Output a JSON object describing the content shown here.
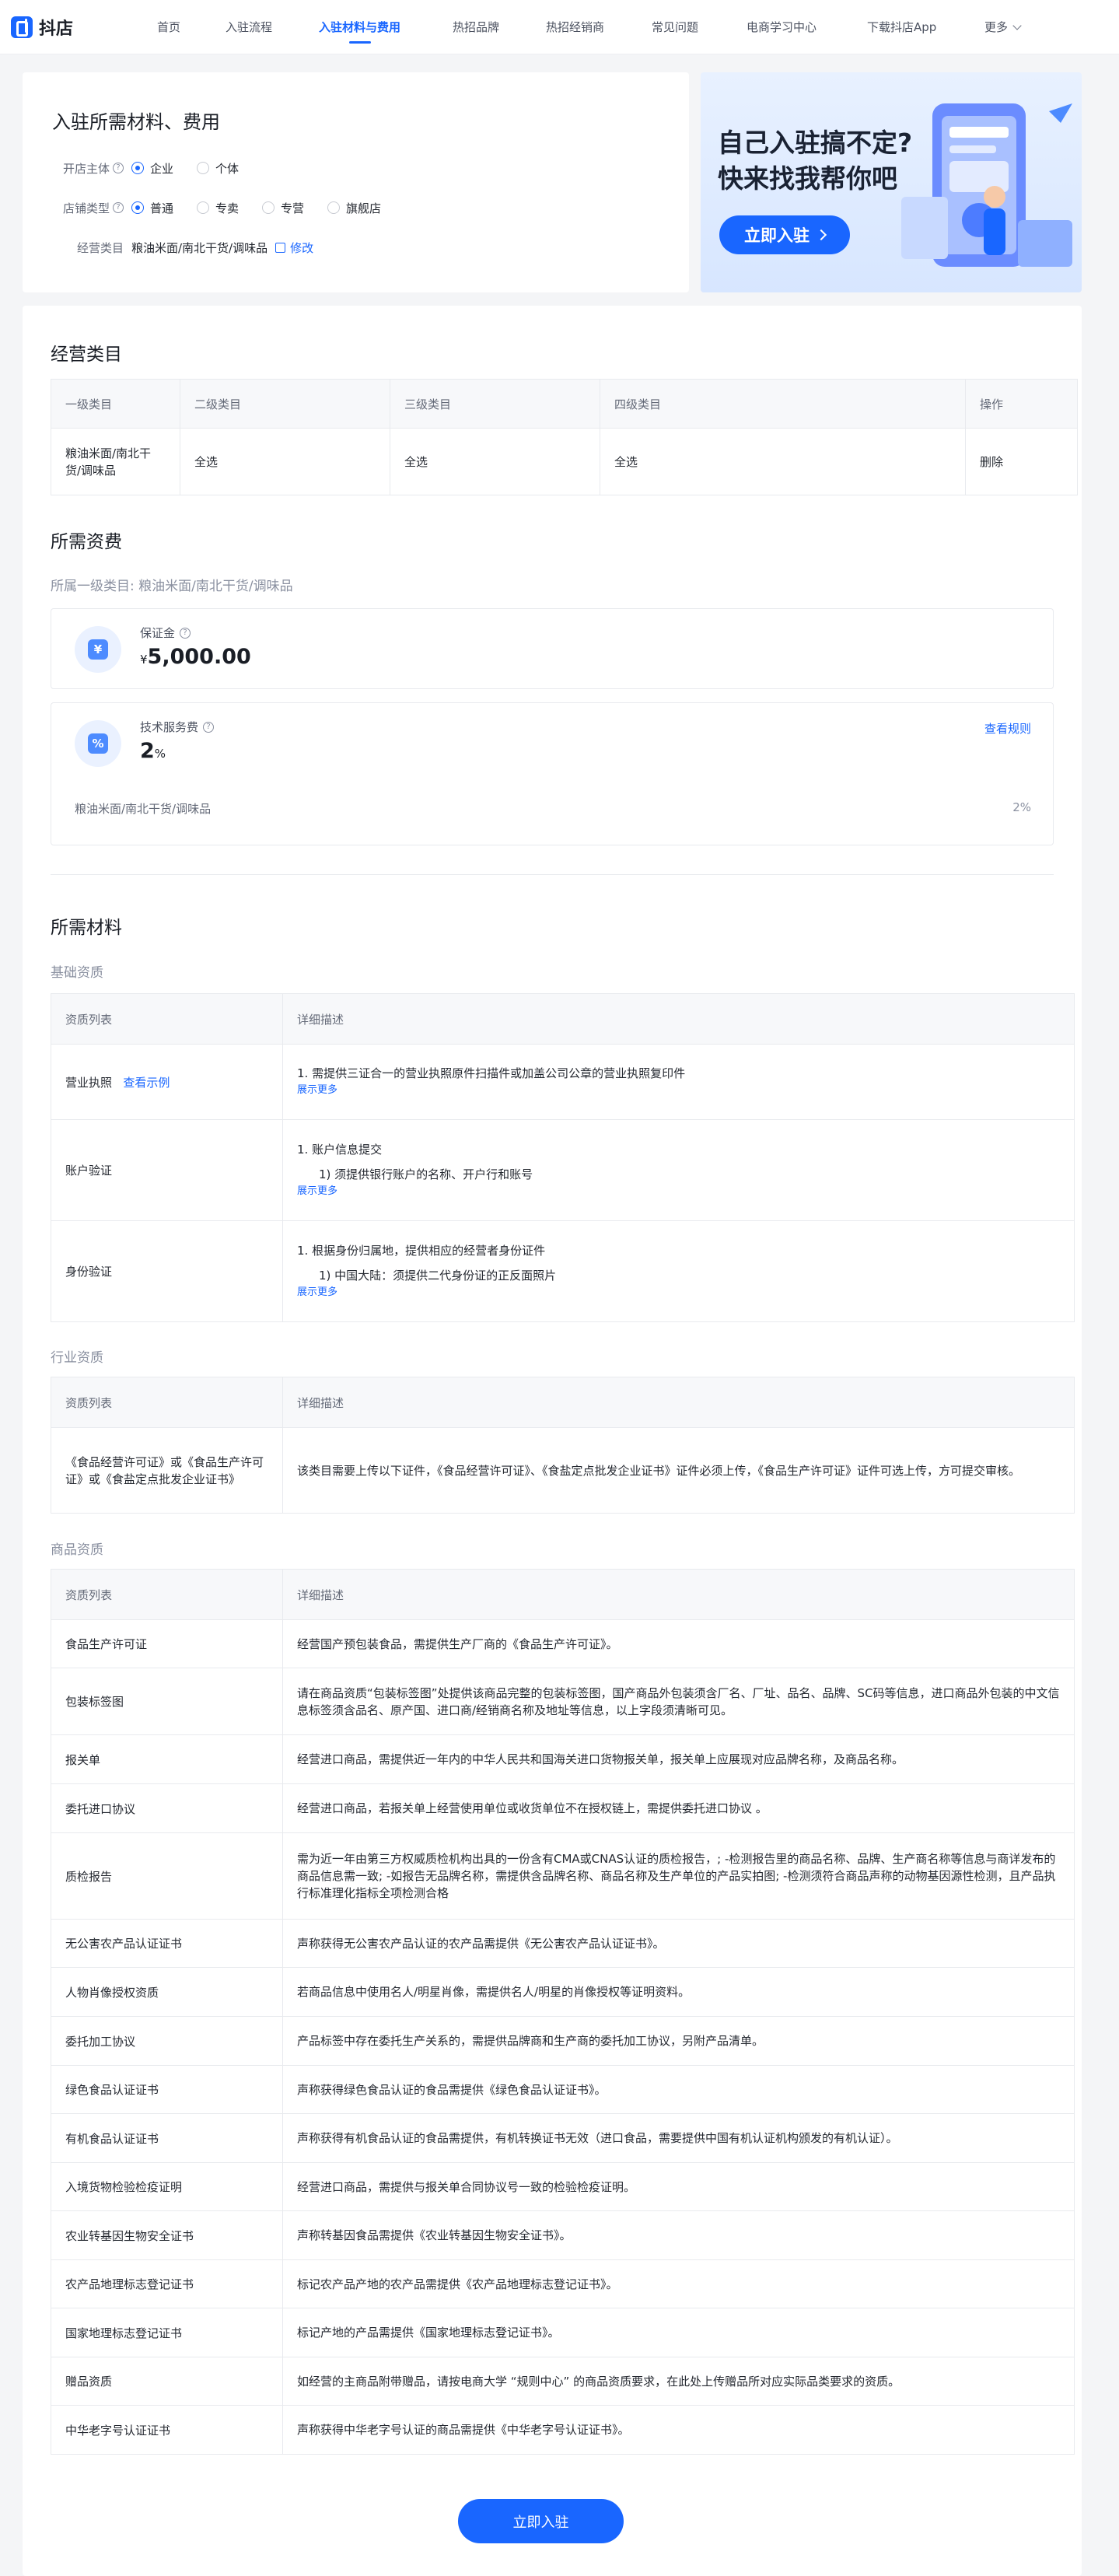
{
  "nav": {
    "logo_text": "抖店",
    "items": [
      "首页",
      "入驻流程",
      "入驻材料与费用",
      "热招品牌",
      "热招经销商",
      "常见问题",
      "电商学习中心",
      "下载抖店App",
      "更多"
    ]
  },
  "top_card": {
    "title": "入驻所需材料、费用",
    "subject": {
      "label": "开店主体",
      "options": [
        "企业",
        "个体"
      ],
      "selected": "企业"
    },
    "store_type": {
      "label": "店铺类型",
      "options": [
        "普通",
        "专卖",
        "专营",
        "旗舰店"
      ],
      "selected": "普通"
    },
    "category": {
      "label": "经营类目",
      "value": "粮油米面/南北干货/调味品",
      "edit": "修改"
    }
  },
  "banner": {
    "line1": "自己入驻搞不定?",
    "line2": "快来找我帮你吧",
    "button": "立即入驻"
  },
  "category_section": {
    "title": "经营类目",
    "headers": [
      "一级类目",
      "二级类目",
      "三级类目",
      "四级类目",
      "操作"
    ],
    "row": [
      "粮油米面/南北干货/调味品",
      "全选",
      "全选",
      "全选",
      "删除"
    ]
  },
  "fees": {
    "title": "所需资费",
    "subtitle": "所属一级类目:  粮油米面/南北干货/调味品",
    "deposit": {
      "label": "保证金",
      "currency": "¥",
      "value": "5,000.00"
    },
    "service": {
      "label": "技术服务费",
      "value": "2",
      "unit": "%",
      "rule_link": "查看规则",
      "row_label": "粮油米面/南北干货/调味品",
      "row_value": "2%"
    }
  },
  "materials": {
    "title": "所需材料",
    "basic": {
      "title": "基础资质",
      "headers": [
        "资质列表",
        "详细描述"
      ],
      "rows": [
        {
          "name": "营业执照",
          "link": "查看示例",
          "line1": "1. 需提供三证合一的营业执照原件扫描件或加盖公司公章的营业执照复印件",
          "line2": "",
          "more": "展示更多"
        },
        {
          "name": "账户验证",
          "link": "",
          "line1": "1. 账户信息提交",
          "line2": "1) 须提供银行账户的名称、开户行和账号",
          "more": "展示更多"
        },
        {
          "name": "身份验证",
          "link": "",
          "line1": "1. 根据身份归属地，提供相应的经营者身份证件",
          "line2": "1) 中国大陆：须提供二代身份证的正反面照片",
          "more": "展示更多"
        }
      ]
    },
    "industry": {
      "title": "行业资质",
      "headers": [
        "资质列表",
        "详细描述"
      ],
      "rows": [
        {
          "name": "《食品经营许可证》或《食品生产许可证》或《食盐定点批发企业证书》",
          "desc": "该类目需要上传以下证件，《食品经营许可证》、《食盐定点批发企业证书》证件必须上传，《食品生产许可证》证件可选上传，方可提交审核。"
        }
      ]
    },
    "goods": {
      "title": "商品资质",
      "headers": [
        "资质列表",
        "详细描述"
      ],
      "rows": [
        {
          "name": "食品生产许可证",
          "desc": "经营国产预包装食品，需提供生产厂商的《食品生产许可证》。"
        },
        {
          "name": "包装标签图",
          "desc": "请在商品资质“包装标签图”处提供该商品完整的包装标签图，国产商品外包装须含厂名、厂址、品名、品牌、SC码等信息，进口商品外包装的中文信息标签须含品名、原产国、进口商/经销商名称及地址等信息，以上字段须清晰可见。"
        },
        {
          "name": "报关单",
          "desc": "经营进口商品，需提供近一年内的中华人民共和国海关进口货物报关单，报关单上应展现对应品牌名称，及商品名称。"
        },
        {
          "name": "委托进口协议",
          "desc": "经营进口商品，若报关单上经营使用单位或收货单位不在授权链上，需提供委托进口协议 。"
        },
        {
          "name": "质检报告",
          "desc": "需为近一年由第三方权威质检机构出具的一份含有CMA或CNAS认证的质检报告，; -检测报告里的商品名称、品牌、生产商名称等信息与商详发布的商品信息需一致; -如报告无品牌名称，需提供含品牌名称、商品名称及生产单位的产品实拍图; -检测须符合商品声称的动物基因源性检测，且产品执行标准理化指标全项检测合格"
        },
        {
          "name": "无公害农产品认证证书",
          "desc": "声称获得无公害农产品认证的农产品需提供《无公害农产品认证证书》。"
        },
        {
          "name": "人物肖像授权资质",
          "desc": "若商品信息中使用名人/明星肖像，需提供名人/明星的肖像授权等证明资料。"
        },
        {
          "name": "委托加工协议",
          "desc": "产品标签中存在委托生产关系的，需提供品牌商和生产商的委托加工协议，另附产品清单。"
        },
        {
          "name": "绿色食品认证证书",
          "desc": "声称获得绿色食品认证的食品需提供《绿色食品认证证书》。"
        },
        {
          "name": "有机食品认证证书",
          "desc": "声称获得有机食品认证的食品需提供，有机转换证书无效（进口食品，需要提供中国有机认证机构颁发的有机认证）。"
        },
        {
          "name": "入境货物检验检疫证明",
          "desc": "经营进口商品，需提供与报关单合同协议号一致的检验检疫证明。"
        },
        {
          "name": "农业转基因生物安全证书",
          "desc": "声称转基因食品需提供《农业转基因生物安全证书》。"
        },
        {
          "name": "农产品地理标志登记证书",
          "desc": "标记农产品产地的农产品需提供《农产品地理标志登记证书》。"
        },
        {
          "name": "国家地理标志登记证书",
          "desc": "标记产地的产品需提供《国家地理标志登记证书》。"
        },
        {
          "name": "赠品资质",
          "desc": "如经营的主商品附带赠品，请按电商大学 “规则中心” 的商品资质要求，在此处上传赠品所对应实际品类要求的资质。"
        },
        {
          "name": "中华老字号认证证书",
          "desc": "声称获得中华老字号认证的商品需提供《中华老字号认证证书》。"
        }
      ]
    }
  },
  "submit_button": "立即入驻"
}
